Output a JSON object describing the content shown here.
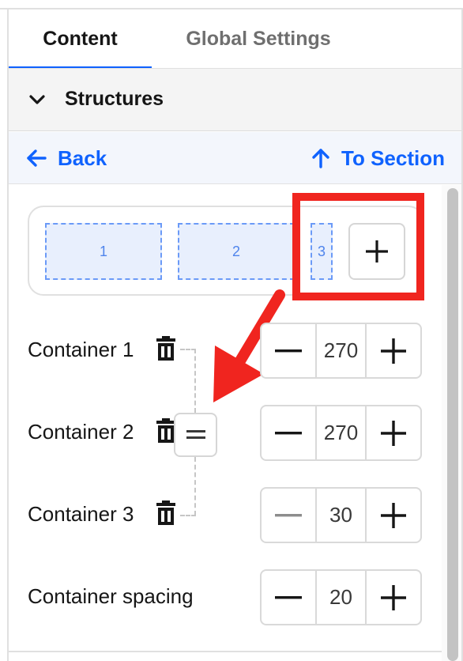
{
  "tabs": [
    {
      "label": "Content",
      "active": true
    },
    {
      "label": "Global Settings",
      "active": false
    }
  ],
  "accordion": {
    "title": "Structures",
    "icon": "chevron-down-icon"
  },
  "nav": {
    "back_label": "Back",
    "to_section_label": "To Section"
  },
  "preview": {
    "slots": [
      "1",
      "2",
      "3"
    ],
    "add_icon": "plus-icon"
  },
  "containers": [
    {
      "label": "Container 1",
      "value": "270",
      "minus_enabled": true
    },
    {
      "label": "Container 2",
      "value": "270",
      "minus_enabled": true
    },
    {
      "label": "Container 3",
      "value": "30",
      "minus_enabled": false
    }
  ],
  "spacing": {
    "label": "Container spacing",
    "value": "20"
  },
  "colors": {
    "accent": "#0f62fe",
    "annotation": "#f0251f",
    "slot_border": "#6b9af7",
    "slot_fill": "#e8effd"
  }
}
